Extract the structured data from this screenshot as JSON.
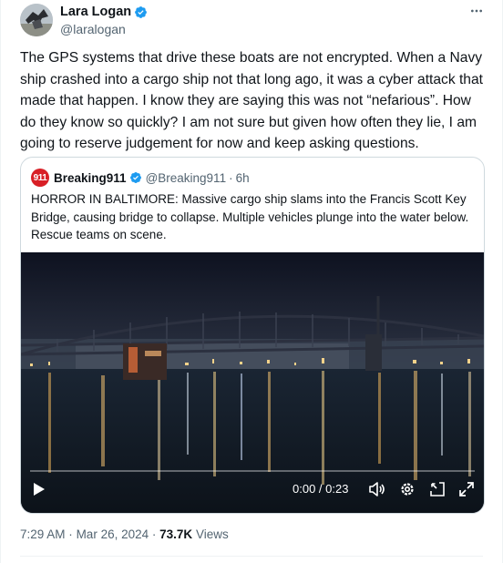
{
  "author": {
    "display_name": "Lara Logan",
    "handle": "@laralogan",
    "verified_color": "#1d9bf0"
  },
  "more_icon": "more-horizontal-icon",
  "post": {
    "text": "The GPS systems that drive these boats are not encrypted. When a Navy ship crashed into a cargo ship not that long ago, it was a cyber attack that made that happen. I know they are saying this was not “nefarious”. How do they know so quickly? I am not sure but given how often they lie, I am going to reserve judgement for now and keep asking questions."
  },
  "quote": {
    "avatar_text": "911",
    "avatar_color": "#d81f26",
    "display_name": "Breaking911",
    "handle": "@Breaking911",
    "separator": "·",
    "time": "6h",
    "text": "HORROR IN BALTIMORE: Massive cargo ship slams into the Francis Scott Key Bridge, causing bridge to collapse. Multiple vehicles plunge into the water below. Rescue teams on scene.",
    "video": {
      "time_display": "0:00 / 0:23",
      "progress": 0
    }
  },
  "footer": {
    "time": "7:29 AM",
    "separator1": "·",
    "date": "Mar 26, 2024",
    "separator2": "·",
    "views_count": "73.7K",
    "views_label": "Views"
  }
}
